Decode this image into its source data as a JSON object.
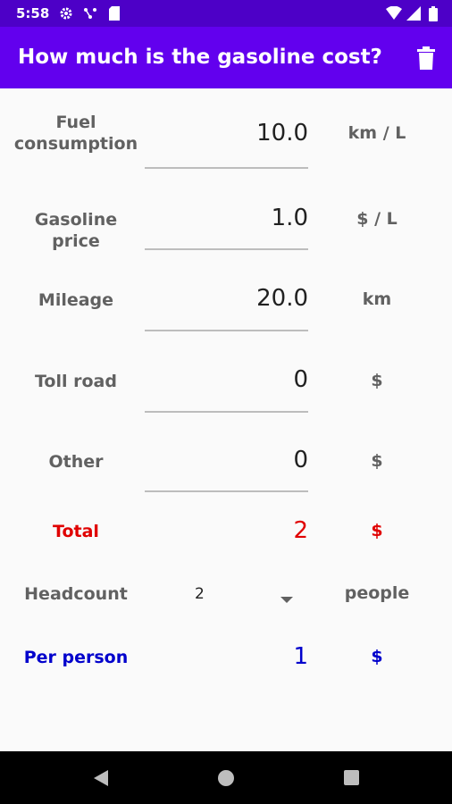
{
  "status_bar": {
    "time": "5:58",
    "icons": [
      "gear-icon",
      "network-icon",
      "sd-card-icon",
      "wifi-icon",
      "signal-icon",
      "battery-icon"
    ]
  },
  "app_bar": {
    "title": "How much is the gasoline cost?",
    "action_icon": "trash-icon"
  },
  "form": {
    "fuel_consumption": {
      "label": "Fuel consumption",
      "value": "10.0",
      "unit": "km / L"
    },
    "gasoline_price": {
      "label": "Gasoline price",
      "value": "1.0",
      "unit": "$ / L"
    },
    "mileage": {
      "label": "Mileage",
      "value": "20.0",
      "unit": "km"
    },
    "toll_road": {
      "label": "Toll road",
      "value": "0",
      "unit": "$"
    },
    "other": {
      "label": "Other",
      "value": "0",
      "unit": "$"
    }
  },
  "total": {
    "label": "Total",
    "value": "2",
    "unit": "$"
  },
  "headcount": {
    "label": "Headcount",
    "selected": "2",
    "unit": "people"
  },
  "per_person": {
    "label": "Per person",
    "value": "1",
    "unit": "$"
  },
  "nav_bar": {
    "buttons": [
      "back-icon",
      "home-icon",
      "recents-icon"
    ]
  },
  "colors": {
    "status_bar": "#4d00c7",
    "app_bar": "#6200ee",
    "total": "#e00000",
    "per_person": "#0000cc"
  }
}
